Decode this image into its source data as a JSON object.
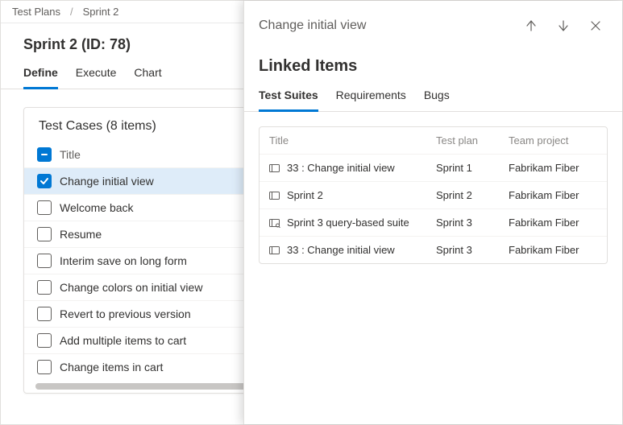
{
  "breadcrumb": {
    "root": "Test Plans",
    "current": "Sprint 2"
  },
  "title": "Sprint 2 (ID: 78)",
  "main_tabs": [
    {
      "label": "Define",
      "active": true
    },
    {
      "label": "Execute",
      "active": false
    },
    {
      "label": "Chart",
      "active": false
    }
  ],
  "card": {
    "header": "Test Cases (8 items)",
    "title_col": "Title",
    "items": [
      {
        "label": "Change initial view",
        "checked": true,
        "selected": true
      },
      {
        "label": "Welcome back",
        "checked": false,
        "selected": false
      },
      {
        "label": "Resume",
        "checked": false,
        "selected": false
      },
      {
        "label": "Interim save on long form",
        "checked": false,
        "selected": false
      },
      {
        "label": "Change colors on initial view",
        "checked": false,
        "selected": false
      },
      {
        "label": "Revert to previous version",
        "checked": false,
        "selected": false
      },
      {
        "label": "Add multiple items to cart",
        "checked": false,
        "selected": false
      },
      {
        "label": "Change items in cart",
        "checked": false,
        "selected": false
      }
    ]
  },
  "panel": {
    "title": "Change initial view",
    "section_title": "Linked Items",
    "tabs": [
      {
        "label": "Test Suites",
        "active": true
      },
      {
        "label": "Requirements",
        "active": false
      },
      {
        "label": "Bugs",
        "active": false
      }
    ],
    "columns": {
      "title": "Title",
      "plan": "Test plan",
      "team": "Team project"
    },
    "rows": [
      {
        "icon": "static-suite",
        "title": "33 : Change initial view",
        "plan": "Sprint 1",
        "team": "Fabrikam Fiber"
      },
      {
        "icon": "static-suite",
        "title": "Sprint 2",
        "plan": "Sprint 2",
        "team": "Fabrikam Fiber"
      },
      {
        "icon": "query-suite",
        "title": "Sprint 3 query-based suite",
        "plan": "Sprint 3",
        "team": "Fabrikam Fiber"
      },
      {
        "icon": "static-suite",
        "title": "33 : Change initial view",
        "plan": "Sprint 3",
        "team": "Fabrikam Fiber"
      }
    ]
  }
}
